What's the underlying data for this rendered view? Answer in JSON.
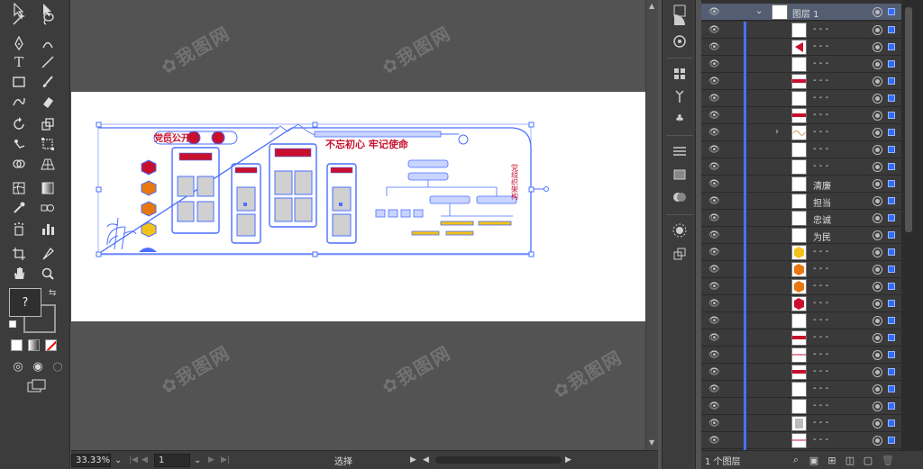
{
  "status": {
    "zoom": "33.33%",
    "artboard_number": "1",
    "tool_status": "选择"
  },
  "artwork": {
    "banner_title": "党员公开栏",
    "slogan": "不忘初心 牢记使命",
    "org_title": "党组织架构"
  },
  "layers": {
    "parent_name": "图层 1",
    "footer_label": "1 个图层",
    "rows": [
      {
        "name": "- - -"
      },
      {
        "name": "- - -"
      },
      {
        "name": "- - -"
      },
      {
        "name": "- - -"
      },
      {
        "name": "- - -"
      },
      {
        "name": "- - -"
      },
      {
        "name": "- - -"
      },
      {
        "name": "- - -"
      },
      {
        "name": "- - -"
      },
      {
        "name": "清廉"
      },
      {
        "name": "担当"
      },
      {
        "name": "忠诚"
      },
      {
        "name": "为民"
      },
      {
        "name": "- - -"
      },
      {
        "name": "- - -"
      },
      {
        "name": "- - -"
      },
      {
        "name": "- - -"
      },
      {
        "name": "- - -"
      },
      {
        "name": "- - -"
      },
      {
        "name": "- - -"
      },
      {
        "name": "- - -"
      },
      {
        "name": "- - -"
      },
      {
        "name": "- - -"
      },
      {
        "name": "- - -"
      },
      {
        "name": "- - -"
      },
      {
        "name": "- - -"
      }
    ]
  },
  "colors": {
    "selection_blue": "#4a6fff",
    "party_red": "#c8102e",
    "hexagon_orange": "#e8770f",
    "hexagon_yellow": "#f3c21a"
  }
}
